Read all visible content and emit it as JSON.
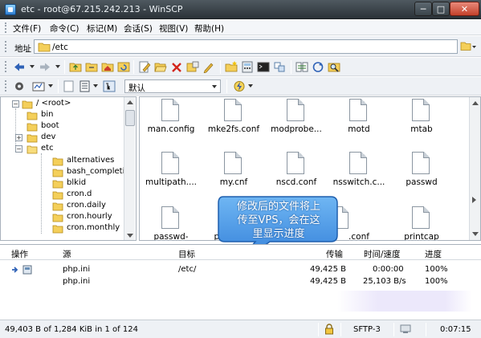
{
  "window": {
    "title": "etc - root@67.215.242.213 - WinSCP",
    "minimize": "─",
    "maximize": "□",
    "close": "✕"
  },
  "menu": [
    "文件(F)",
    "命令(C)",
    "标记(M)",
    "会话(S)",
    "视图(V)",
    "帮助(H)"
  ],
  "address": {
    "label": "地址",
    "path": "/etc"
  },
  "toolbar2": {
    "profile": "默认"
  },
  "tree": {
    "root": "/ <root>",
    "items": [
      {
        "label": "bin",
        "level": 1
      },
      {
        "label": "boot",
        "level": 1
      },
      {
        "label": "dev",
        "level": 1,
        "expander": "+"
      },
      {
        "label": "etc",
        "level": 1,
        "expander": "−"
      },
      {
        "label": "alternatives",
        "level": 2
      },
      {
        "label": "bash_completion",
        "level": 2
      },
      {
        "label": "blkid",
        "level": 2
      },
      {
        "label": "cron.d",
        "level": 2
      },
      {
        "label": "cron.daily",
        "level": 2
      },
      {
        "label": "cron.hourly",
        "level": 2
      },
      {
        "label": "cron.monthly",
        "level": 2
      }
    ]
  },
  "files": [
    "man.config",
    "mke2fs.conf",
    "modprobe...",
    "motd",
    "mtab",
    "multipath....",
    "my.cnf",
    "nscd.conf",
    "nsswitch.c...",
    "passwd",
    "passwd-",
    "pa",
    "",
    ".conf",
    "printcap"
  ],
  "callout": {
    "line1": "修改后的文件将上",
    "line2": "传至VPS，会在这",
    "line3": "里显示进度"
  },
  "queue": {
    "headers": [
      "操作",
      "源",
      "目标",
      "传输",
      "时间/速度",
      "进度"
    ],
    "rows": [
      {
        "source": "php.ini",
        "target": "/etc/",
        "transferred": "49,425 B",
        "time": "0:00:00",
        "progress": "100%"
      },
      {
        "source": "php.ini",
        "target": "",
        "transferred": "49,425 B",
        "time": "25,103 B/s",
        "progress": "100%"
      }
    ]
  },
  "status": {
    "selection": "49,403 B of 1,284 KiB in 1 of 124",
    "protocol": "SFTP-3",
    "elapsed": "0:07:15"
  }
}
